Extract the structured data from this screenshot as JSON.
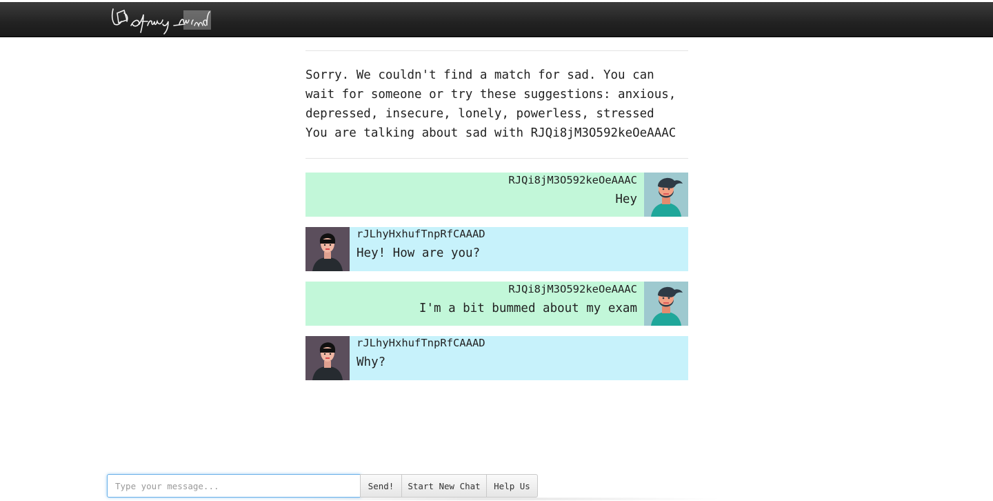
{
  "header": {
    "logo_text": "Out of my mind"
  },
  "status": {
    "line1": "Sorry. We couldn't find a match for sad. You can wait for someone or try these suggestions: anxious, depressed, insecure, lonely, powerless, stressed",
    "line2": "You are talking about sad with RJQi8jM3O592keOeAAAC"
  },
  "messages": [
    {
      "sender": "RJQi8jM3O592keOeAAAC",
      "text": "Hey",
      "side": "self"
    },
    {
      "sender": "rJLhyHxhufTnpRfCAAAD",
      "text": "Hey! How are you?",
      "side": "other"
    },
    {
      "sender": "RJQi8jM3O592keOeAAAC",
      "text": "I'm a bit bummed about my exam",
      "side": "self"
    },
    {
      "sender": "rJLhyHxhufTnpRfCAAAD",
      "text": "Why?",
      "side": "other"
    }
  ],
  "composer": {
    "placeholder": "Type your message...",
    "send_label": "Send!",
    "new_chat_label": "Start New Chat",
    "help_label": "Help Us"
  },
  "colors": {
    "self_bubble": "#c2f7d9",
    "other_bubble": "#c7f2fb",
    "navbar": "#222222"
  }
}
